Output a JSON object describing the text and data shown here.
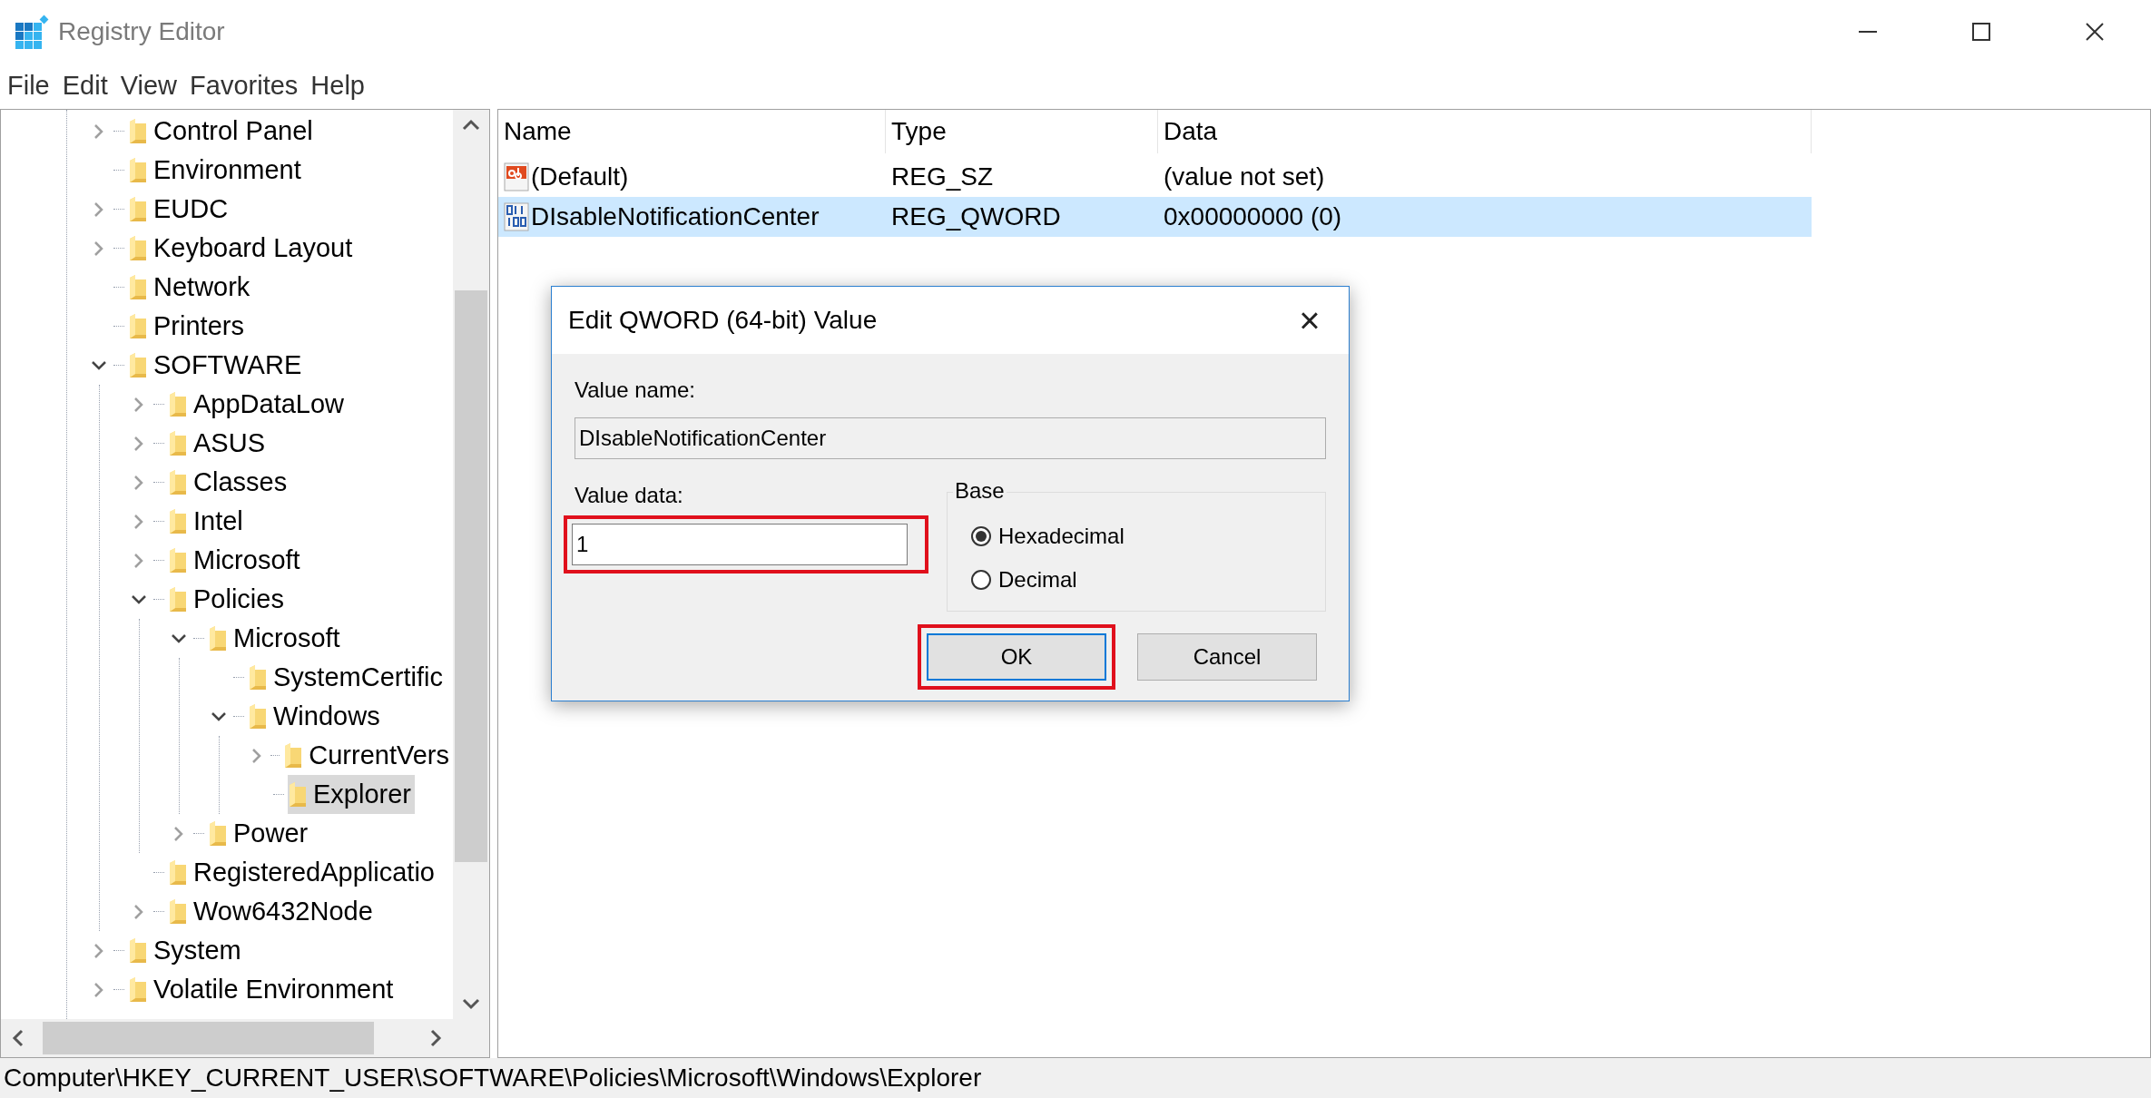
{
  "window": {
    "title": "Registry Editor"
  },
  "menu": [
    "File",
    "Edit",
    "View",
    "Favorites",
    "Help"
  ],
  "tree": [
    {
      "label": "Control Panel",
      "expanded": false,
      "selected": false
    },
    {
      "label": "Environment",
      "selected": false
    },
    {
      "label": "EUDC",
      "expanded": false,
      "selected": false
    },
    {
      "label": "Keyboard Layout",
      "expanded": false,
      "selected": false
    },
    {
      "label": "Network",
      "selected": false
    },
    {
      "label": "Printers",
      "selected": false
    },
    {
      "label": "SOFTWARE",
      "expanded": true,
      "selected": false,
      "children": [
        {
          "label": "AppDataLow",
          "expanded": false,
          "selected": false
        },
        {
          "label": "ASUS",
          "expanded": false,
          "selected": false
        },
        {
          "label": "Classes",
          "expanded": false,
          "selected": false
        },
        {
          "label": "Intel",
          "expanded": false,
          "selected": false
        },
        {
          "label": "Microsoft",
          "expanded": false,
          "selected": false
        },
        {
          "label": "Policies",
          "expanded": true,
          "selected": false,
          "children": [
            {
              "label": "Microsoft",
              "expanded": true,
              "selected": false,
              "children": [
                {
                  "label": "SystemCertific",
                  "selected": false
                },
                {
                  "label": "Windows",
                  "expanded": true,
                  "selected": false,
                  "children": [
                    {
                      "label": "CurrentVers",
                      "expanded": false,
                      "selected": false
                    },
                    {
                      "label": "Explorer",
                      "selected": true
                    }
                  ]
                }
              ]
            },
            {
              "label": "Power",
              "expanded": false,
              "selected": false
            }
          ]
        },
        {
          "label": "RegisteredApplicatio",
          "selected": false
        },
        {
          "label": "Wow6432Node",
          "expanded": false,
          "selected": false
        }
      ]
    },
    {
      "label": "System",
      "expanded": false,
      "selected": false
    },
    {
      "label": "Volatile Environment",
      "expanded": false,
      "selected": false
    }
  ],
  "table": {
    "columns": [
      "Name",
      "Type",
      "Data"
    ],
    "rows": [
      {
        "kind": "string",
        "name": "(Default)",
        "type": "REG_SZ",
        "data": "(value not set)",
        "selected": false
      },
      {
        "kind": "binary",
        "name": "DIsableNotificationCenter",
        "type": "REG_QWORD",
        "data": "0x00000000 (0)",
        "selected": true
      }
    ]
  },
  "dialog": {
    "title": "Edit QWORD (64-bit) Value",
    "close": "×",
    "value_name_label": "Value name:",
    "value_name": "DIsableNotificationCenter",
    "value_data_label": "Value data:",
    "value_data": "1",
    "value_data_highlighted": true,
    "base_label": "Base",
    "base_options": [
      {
        "label": "Hexadecimal",
        "selected": true
      },
      {
        "label": "Decimal",
        "selected": false
      }
    ],
    "buttons": [
      {
        "label": "OK",
        "default": true,
        "highlighted": true
      },
      {
        "label": "Cancel",
        "default": false,
        "highlighted": false
      }
    ]
  },
  "status_bar": "Computer\\HKEY_CURRENT_USER\\SOFTWARE\\Policies\\Microsoft\\Windows\\Explorer"
}
